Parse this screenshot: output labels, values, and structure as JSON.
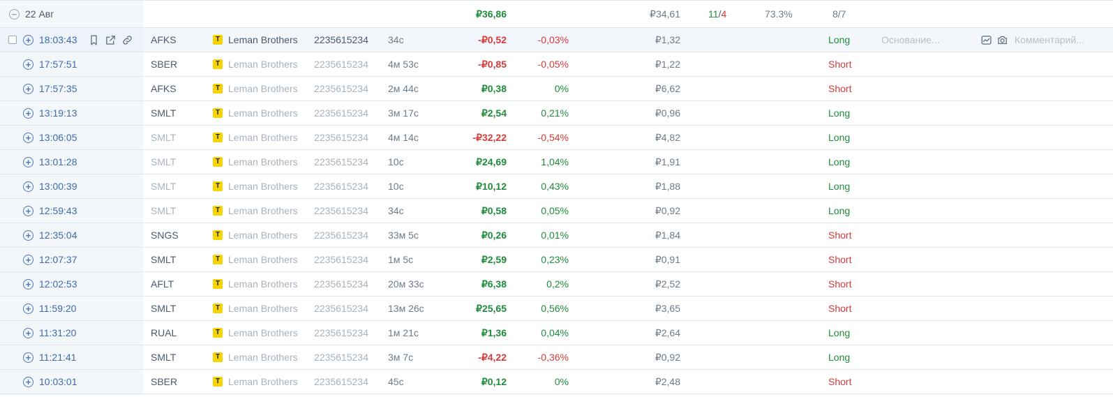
{
  "group": {
    "date": "22 Авг",
    "pnl": "₽36,86",
    "fee": "₽34,61",
    "wins": "11",
    "sep": "/",
    "losses": "4",
    "winrate": "73.3%",
    "long_short": "8/7"
  },
  "first_row_extra": {
    "reason_placeholder": "Основание...",
    "comment_placeholder": "Комментарий..."
  },
  "colors": {
    "positive": "#1e8c3a",
    "negative": "#d63a3a",
    "accent": "#3b6bb0"
  },
  "trades": [
    {
      "time": "18:03:43",
      "ticker": "AFKS",
      "ticker_style": "normal",
      "broker": "Leman Brothers",
      "account": "2235615234",
      "duration": "34с",
      "pnl": "-₽0,52",
      "pnl_sign": "neg",
      "pct": "-0,03%",
      "pct_sign": "neg",
      "fee": "₽1,32",
      "side": "Long"
    },
    {
      "time": "17:57:51",
      "ticker": "SBER",
      "ticker_style": "normal",
      "broker": "Leman Brothers",
      "account": "2235615234",
      "duration": "4м 53с",
      "pnl": "-₽0,85",
      "pnl_sign": "neg",
      "pct": "-0,05%",
      "pct_sign": "neg",
      "fee": "₽1,22",
      "side": "Short"
    },
    {
      "time": "17:57:35",
      "ticker": "AFKS",
      "ticker_style": "normal",
      "broker": "Leman Brothers",
      "account": "2235615234",
      "duration": "2м 44с",
      "pnl": "₽0,38",
      "pnl_sign": "pos",
      "pct": "0%",
      "pct_sign": "pos",
      "fee": "₽6,62",
      "side": "Short"
    },
    {
      "time": "13:19:13",
      "ticker": "SMLT",
      "ticker_style": "normal",
      "broker": "Leman Brothers",
      "account": "2235615234",
      "duration": "3м 17с",
      "pnl": "₽2,54",
      "pnl_sign": "pos",
      "pct": "0,21%",
      "pct_sign": "pos",
      "fee": "₽0,96",
      "side": "Long"
    },
    {
      "time": "13:06:05",
      "ticker": "SMLT",
      "ticker_style": "dim",
      "broker": "Leman Brothers",
      "account": "2235615234",
      "duration": "4м 14с",
      "pnl": "-₽32,22",
      "pnl_sign": "neg",
      "pct": "-0,54%",
      "pct_sign": "neg",
      "fee": "₽4,82",
      "side": "Long"
    },
    {
      "time": "13:01:28",
      "ticker": "SMLT",
      "ticker_style": "dim",
      "broker": "Leman Brothers",
      "account": "2235615234",
      "duration": "10с",
      "pnl": "₽24,69",
      "pnl_sign": "pos",
      "pct": "1,04%",
      "pct_sign": "pos",
      "fee": "₽1,91",
      "side": "Long"
    },
    {
      "time": "13:00:39",
      "ticker": "SMLT",
      "ticker_style": "dim",
      "broker": "Leman Brothers",
      "account": "2235615234",
      "duration": "10с",
      "pnl": "₽10,12",
      "pnl_sign": "pos",
      "pct": "0,43%",
      "pct_sign": "pos",
      "fee": "₽1,88",
      "side": "Long"
    },
    {
      "time": "12:59:43",
      "ticker": "SMLT",
      "ticker_style": "dim",
      "broker": "Leman Brothers",
      "account": "2235615234",
      "duration": "34с",
      "pnl": "₽0,58",
      "pnl_sign": "pos",
      "pct": "0,05%",
      "pct_sign": "pos",
      "fee": "₽0,92",
      "side": "Long"
    },
    {
      "time": "12:35:04",
      "ticker": "SNGS",
      "ticker_style": "normal",
      "broker": "Leman Brothers",
      "account": "2235615234",
      "duration": "33м 5с",
      "pnl": "₽0,26",
      "pnl_sign": "pos",
      "pct": "0,01%",
      "pct_sign": "pos",
      "fee": "₽1,84",
      "side": "Short"
    },
    {
      "time": "12:07:37",
      "ticker": "SMLT",
      "ticker_style": "normal",
      "broker": "Leman Brothers",
      "account": "2235615234",
      "duration": "1м 5с",
      "pnl": "₽2,59",
      "pnl_sign": "pos",
      "pct": "0,23%",
      "pct_sign": "pos",
      "fee": "₽0,91",
      "side": "Short"
    },
    {
      "time": "12:02:53",
      "ticker": "AFLT",
      "ticker_style": "normal",
      "broker": "Leman Brothers",
      "account": "2235615234",
      "duration": "20м 33с",
      "pnl": "₽6,38",
      "pnl_sign": "pos",
      "pct": "0,2%",
      "pct_sign": "pos",
      "fee": "₽2,52",
      "side": "Short"
    },
    {
      "time": "11:59:20",
      "ticker": "SMLT",
      "ticker_style": "normal",
      "broker": "Leman Brothers",
      "account": "2235615234",
      "duration": "13м 26с",
      "pnl": "₽25,65",
      "pnl_sign": "pos",
      "pct": "0,56%",
      "pct_sign": "pos",
      "fee": "₽3,65",
      "side": "Short"
    },
    {
      "time": "11:31:20",
      "ticker": "RUAL",
      "ticker_style": "normal",
      "broker": "Leman Brothers",
      "account": "2235615234",
      "duration": "1м 21с",
      "pnl": "₽1,36",
      "pnl_sign": "pos",
      "pct": "0,04%",
      "pct_sign": "pos",
      "fee": "₽2,64",
      "side": "Long"
    },
    {
      "time": "11:21:41",
      "ticker": "SMLT",
      "ticker_style": "normal",
      "broker": "Leman Brothers",
      "account": "2235615234",
      "duration": "3м 7с",
      "pnl": "-₽4,22",
      "pnl_sign": "neg",
      "pct": "-0,36%",
      "pct_sign": "neg",
      "fee": "₽0,92",
      "side": "Long"
    },
    {
      "time": "10:03:01",
      "ticker": "SBER",
      "ticker_style": "normal",
      "broker": "Leman Brothers",
      "account": "2235615234",
      "duration": "45с",
      "pnl": "₽0,12",
      "pnl_sign": "pos",
      "pct": "0%",
      "pct_sign": "pos",
      "fee": "₽2,48",
      "side": "Short"
    }
  ]
}
